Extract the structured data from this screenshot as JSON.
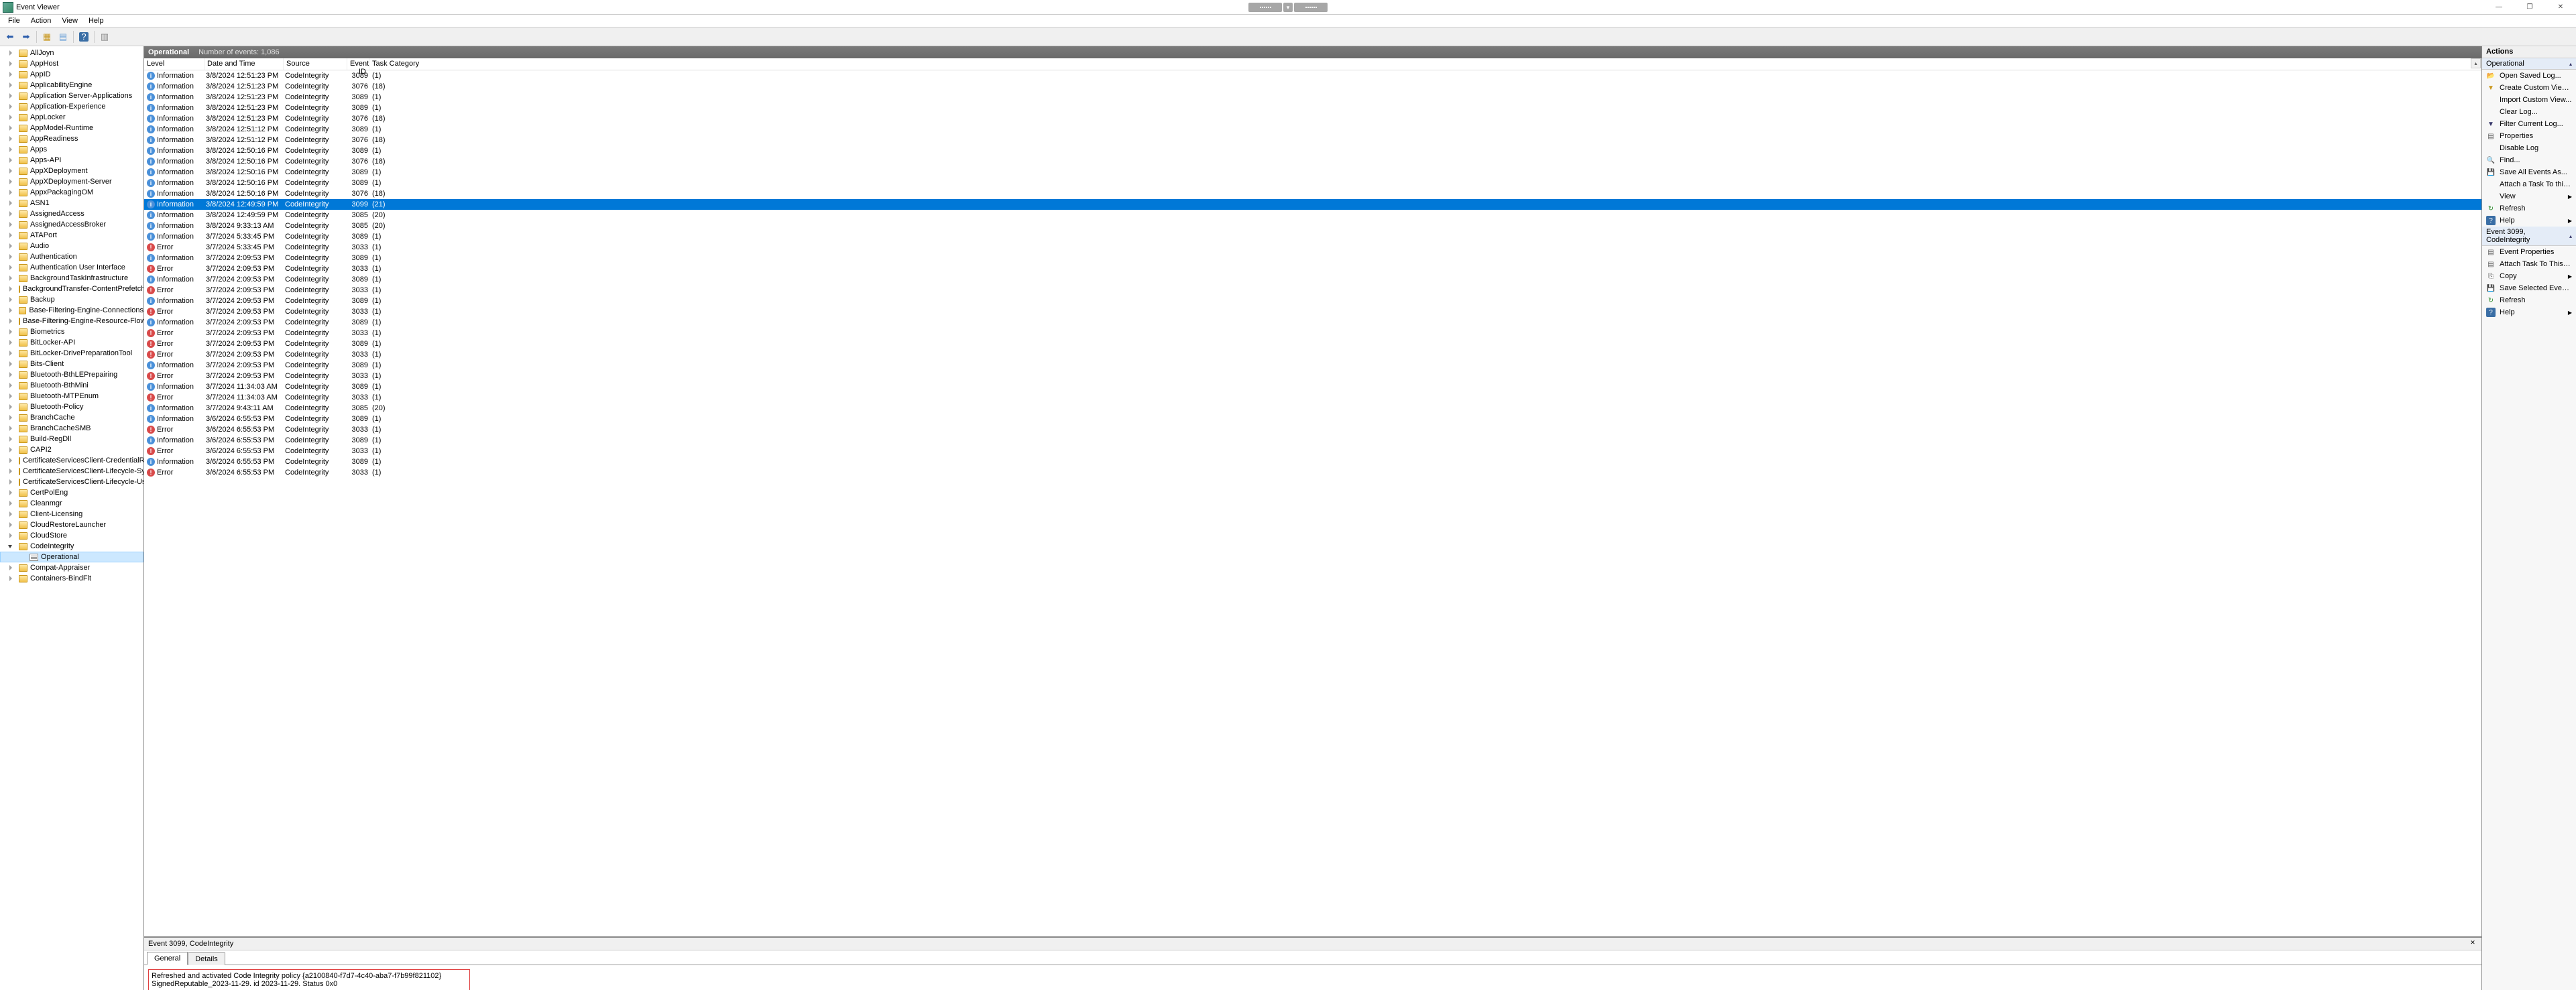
{
  "window": {
    "title": "Event Viewer"
  },
  "menu": {
    "file": "File",
    "action": "Action",
    "view": "View",
    "help": "Help"
  },
  "tree": {
    "items": [
      {
        "label": "AllJoyn"
      },
      {
        "label": "AppHost"
      },
      {
        "label": "AppID"
      },
      {
        "label": "ApplicabilityEngine"
      },
      {
        "label": "Application Server-Applications"
      },
      {
        "label": "Application-Experience"
      },
      {
        "label": "AppLocker"
      },
      {
        "label": "AppModel-Runtime"
      },
      {
        "label": "AppReadiness"
      },
      {
        "label": "Apps"
      },
      {
        "label": "Apps-API"
      },
      {
        "label": "AppXDeployment"
      },
      {
        "label": "AppXDeployment-Server"
      },
      {
        "label": "AppxPackagingOM"
      },
      {
        "label": "ASN1"
      },
      {
        "label": "AssignedAccess"
      },
      {
        "label": "AssignedAccessBroker"
      },
      {
        "label": "ATAPort"
      },
      {
        "label": "Audio"
      },
      {
        "label": "Authentication"
      },
      {
        "label": "Authentication User Interface"
      },
      {
        "label": "BackgroundTaskInfrastructure"
      },
      {
        "label": "BackgroundTransfer-ContentPrefetcher"
      },
      {
        "label": "Backup"
      },
      {
        "label": "Base-Filtering-Engine-Connections"
      },
      {
        "label": "Base-Filtering-Engine-Resource-Flows"
      },
      {
        "label": "Biometrics"
      },
      {
        "label": "BitLocker-API"
      },
      {
        "label": "BitLocker-DrivePreparationTool"
      },
      {
        "label": "Bits-Client"
      },
      {
        "label": "Bluetooth-BthLEPrepairing"
      },
      {
        "label": "Bluetooth-BthMini"
      },
      {
        "label": "Bluetooth-MTPEnum"
      },
      {
        "label": "Bluetooth-Policy"
      },
      {
        "label": "BranchCache"
      },
      {
        "label": "BranchCacheSMB"
      },
      {
        "label": "Build-RegDll"
      },
      {
        "label": "CAPI2"
      },
      {
        "label": "CertificateServicesClient-CredentialRoaming"
      },
      {
        "label": "CertificateServicesClient-Lifecycle-System"
      },
      {
        "label": "CertificateServicesClient-Lifecycle-User"
      },
      {
        "label": "CertPolEng"
      },
      {
        "label": "Cleanmgr"
      },
      {
        "label": "Client-Licensing"
      },
      {
        "label": "CloudRestoreLauncher"
      },
      {
        "label": "CloudStore"
      },
      {
        "label": "CodeIntegrity",
        "expanded": true,
        "children": [
          {
            "label": "Operational",
            "selected": true
          }
        ]
      },
      {
        "label": "Compat-Appraiser"
      },
      {
        "label": "Containers-BindFlt"
      }
    ]
  },
  "center": {
    "title": "Operational",
    "count_label": "Number of events: 1,086",
    "columns": {
      "level": "Level",
      "date": "Date and Time",
      "source": "Source",
      "eventid": "Event ID",
      "category": "Task Category"
    }
  },
  "events": [
    {
      "level": "Information",
      "date": "3/8/2024 12:51:23 PM",
      "source": "CodeIntegrity",
      "id": 3089,
      "cat": "(1)"
    },
    {
      "level": "Information",
      "date": "3/8/2024 12:51:23 PM",
      "source": "CodeIntegrity",
      "id": 3076,
      "cat": "(18)"
    },
    {
      "level": "Information",
      "date": "3/8/2024 12:51:23 PM",
      "source": "CodeIntegrity",
      "id": 3089,
      "cat": "(1)"
    },
    {
      "level": "Information",
      "date": "3/8/2024 12:51:23 PM",
      "source": "CodeIntegrity",
      "id": 3089,
      "cat": "(1)"
    },
    {
      "level": "Information",
      "date": "3/8/2024 12:51:23 PM",
      "source": "CodeIntegrity",
      "id": 3076,
      "cat": "(18)"
    },
    {
      "level": "Information",
      "date": "3/8/2024 12:51:12 PM",
      "source": "CodeIntegrity",
      "id": 3089,
      "cat": "(1)"
    },
    {
      "level": "Information",
      "date": "3/8/2024 12:51:12 PM",
      "source": "CodeIntegrity",
      "id": 3076,
      "cat": "(18)"
    },
    {
      "level": "Information",
      "date": "3/8/2024 12:50:16 PM",
      "source": "CodeIntegrity",
      "id": 3089,
      "cat": "(1)"
    },
    {
      "level": "Information",
      "date": "3/8/2024 12:50:16 PM",
      "source": "CodeIntegrity",
      "id": 3076,
      "cat": "(18)"
    },
    {
      "level": "Information",
      "date": "3/8/2024 12:50:16 PM",
      "source": "CodeIntegrity",
      "id": 3089,
      "cat": "(1)"
    },
    {
      "level": "Information",
      "date": "3/8/2024 12:50:16 PM",
      "source": "CodeIntegrity",
      "id": 3089,
      "cat": "(1)"
    },
    {
      "level": "Information",
      "date": "3/8/2024 12:50:16 PM",
      "source": "CodeIntegrity",
      "id": 3076,
      "cat": "(18)"
    },
    {
      "level": "Information",
      "date": "3/8/2024 12:49:59 PM",
      "source": "CodeIntegrity",
      "id": 3099,
      "cat": "(21)",
      "selected": true
    },
    {
      "level": "Information",
      "date": "3/8/2024 12:49:59 PM",
      "source": "CodeIntegrity",
      "id": 3085,
      "cat": "(20)"
    },
    {
      "level": "Information",
      "date": "3/8/2024 9:33:13 AM",
      "source": "CodeIntegrity",
      "id": 3085,
      "cat": "(20)"
    },
    {
      "level": "Information",
      "date": "3/7/2024 5:33:45 PM",
      "source": "CodeIntegrity",
      "id": 3089,
      "cat": "(1)"
    },
    {
      "level": "Error",
      "date": "3/7/2024 5:33:45 PM",
      "source": "CodeIntegrity",
      "id": 3033,
      "cat": "(1)"
    },
    {
      "level": "Information",
      "date": "3/7/2024 2:09:53 PM",
      "source": "CodeIntegrity",
      "id": 3089,
      "cat": "(1)"
    },
    {
      "level": "Error",
      "date": "3/7/2024 2:09:53 PM",
      "source": "CodeIntegrity",
      "id": 3033,
      "cat": "(1)"
    },
    {
      "level": "Information",
      "date": "3/7/2024 2:09:53 PM",
      "source": "CodeIntegrity",
      "id": 3089,
      "cat": "(1)"
    },
    {
      "level": "Error",
      "date": "3/7/2024 2:09:53 PM",
      "source": "CodeIntegrity",
      "id": 3033,
      "cat": "(1)"
    },
    {
      "level": "Information",
      "date": "3/7/2024 2:09:53 PM",
      "source": "CodeIntegrity",
      "id": 3089,
      "cat": "(1)"
    },
    {
      "level": "Error",
      "date": "3/7/2024 2:09:53 PM",
      "source": "CodeIntegrity",
      "id": 3033,
      "cat": "(1)"
    },
    {
      "level": "Information",
      "date": "3/7/2024 2:09:53 PM",
      "source": "CodeIntegrity",
      "id": 3089,
      "cat": "(1)"
    },
    {
      "level": "Error",
      "date": "3/7/2024 2:09:53 PM",
      "source": "CodeIntegrity",
      "id": 3033,
      "cat": "(1)"
    },
    {
      "level": "Error",
      "date": "3/7/2024 2:09:53 PM",
      "source": "CodeIntegrity",
      "id": 3089,
      "cat": "(1)"
    },
    {
      "level": "Error",
      "date": "3/7/2024 2:09:53 PM",
      "source": "CodeIntegrity",
      "id": 3033,
      "cat": "(1)"
    },
    {
      "level": "Information",
      "date": "3/7/2024 2:09:53 PM",
      "source": "CodeIntegrity",
      "id": 3089,
      "cat": "(1)"
    },
    {
      "level": "Error",
      "date": "3/7/2024 2:09:53 PM",
      "source": "CodeIntegrity",
      "id": 3033,
      "cat": "(1)"
    },
    {
      "level": "Information",
      "date": "3/7/2024 11:34:03 AM",
      "source": "CodeIntegrity",
      "id": 3089,
      "cat": "(1)"
    },
    {
      "level": "Error",
      "date": "3/7/2024 11:34:03 AM",
      "source": "CodeIntegrity",
      "id": 3033,
      "cat": "(1)"
    },
    {
      "level": "Information",
      "date": "3/7/2024 9:43:11 AM",
      "source": "CodeIntegrity",
      "id": 3085,
      "cat": "(20)"
    },
    {
      "level": "Information",
      "date": "3/6/2024 6:55:53 PM",
      "source": "CodeIntegrity",
      "id": 3089,
      "cat": "(1)"
    },
    {
      "level": "Error",
      "date": "3/6/2024 6:55:53 PM",
      "source": "CodeIntegrity",
      "id": 3033,
      "cat": "(1)"
    },
    {
      "level": "Information",
      "date": "3/6/2024 6:55:53 PM",
      "source": "CodeIntegrity",
      "id": 3089,
      "cat": "(1)"
    },
    {
      "level": "Error",
      "date": "3/6/2024 6:55:53 PM",
      "source": "CodeIntegrity",
      "id": 3033,
      "cat": "(1)"
    },
    {
      "level": "Information",
      "date": "3/6/2024 6:55:53 PM",
      "source": "CodeIntegrity",
      "id": 3089,
      "cat": "(1)"
    },
    {
      "level": "Error",
      "date": "3/6/2024 6:55:53 PM",
      "source": "CodeIntegrity",
      "id": 3033,
      "cat": "(1)"
    }
  ],
  "detail": {
    "title": "Event 3099, CodeIntegrity",
    "tabs": {
      "general": "General",
      "details": "Details"
    },
    "message": "Refreshed and activated Code Integrity policy {a2100840-f7d7-4c40-aba7-f7b99f821102} SignedReputable_2023-11-29. id 2023-11-29. Status 0x0"
  },
  "actions": {
    "title": "Actions",
    "section1": "Operational",
    "section2": "Event 3099, CodeIntegrity",
    "items1": [
      {
        "icon": "open",
        "label": "Open Saved Log..."
      },
      {
        "icon": "view",
        "label": "Create Custom View..."
      },
      {
        "icon": "",
        "label": "Import Custom View..."
      },
      {
        "icon": "",
        "label": "Clear Log..."
      },
      {
        "icon": "filter",
        "label": "Filter Current Log..."
      },
      {
        "icon": "prop",
        "label": "Properties"
      },
      {
        "icon": "",
        "label": "Disable Log"
      },
      {
        "icon": "find",
        "label": "Find..."
      },
      {
        "icon": "save",
        "label": "Save All Events As..."
      },
      {
        "icon": "",
        "label": "Attach a Task To this Log..."
      },
      {
        "icon": "",
        "label": "View",
        "arrow": true
      },
      {
        "icon": "refresh",
        "label": "Refresh"
      },
      {
        "icon": "help",
        "label": "Help",
        "arrow": true
      }
    ],
    "items2": [
      {
        "icon": "event",
        "label": "Event Properties"
      },
      {
        "icon": "event",
        "label": "Attach Task To This Event..."
      },
      {
        "icon": "copy",
        "label": "Copy",
        "arrow": true
      },
      {
        "icon": "save",
        "label": "Save Selected Events..."
      },
      {
        "icon": "refresh",
        "label": "Refresh"
      },
      {
        "icon": "help",
        "label": "Help",
        "arrow": true
      }
    ]
  }
}
